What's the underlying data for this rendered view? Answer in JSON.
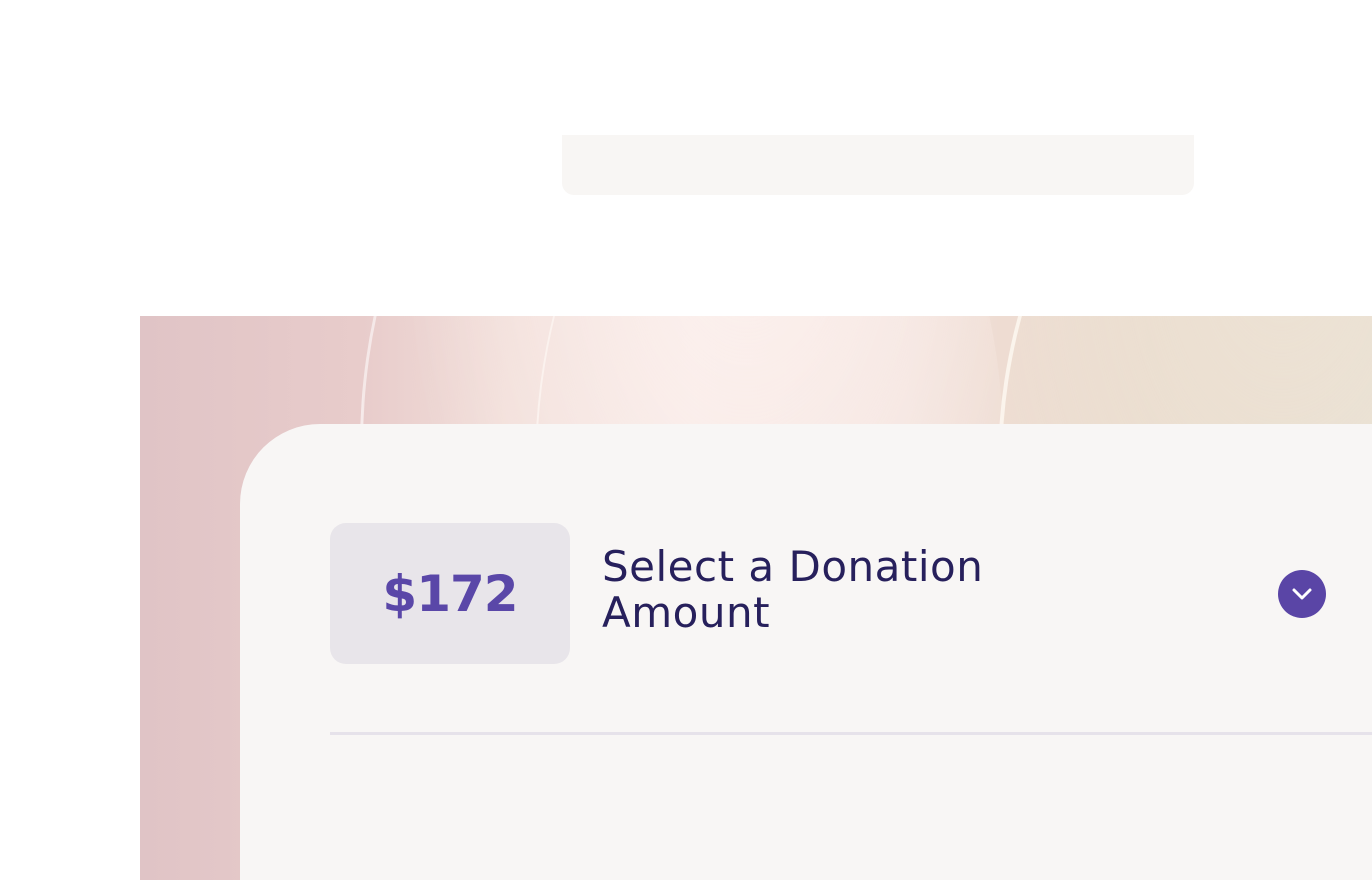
{
  "donation": {
    "amount": "$172",
    "select_label": "Select a Donation Amount"
  },
  "icons": {
    "expand": "chevron-down-icon"
  },
  "colors": {
    "accent": "#5a45a6",
    "title_text": "#27205c",
    "amount_text": "#5a47a8",
    "badge_bg": "#e8e5ea",
    "panel_bg": "#f8f6f5"
  }
}
